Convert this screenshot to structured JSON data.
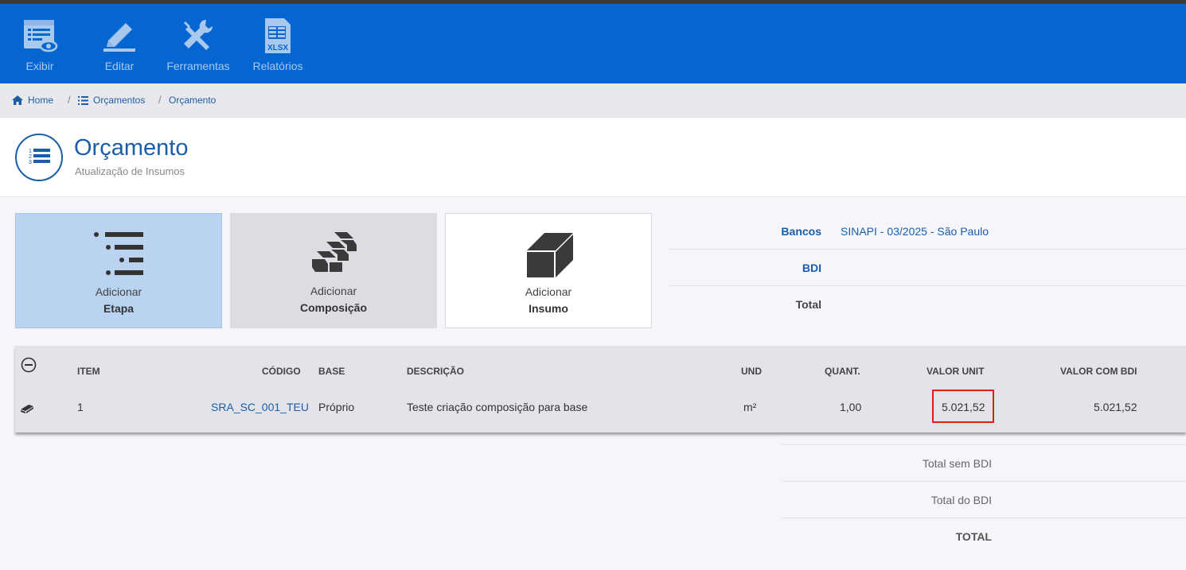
{
  "toolbar": {
    "items": [
      {
        "label": "Exibir",
        "icon": "view-list-eye-icon"
      },
      {
        "label": "Editar",
        "icon": "pencil-icon"
      },
      {
        "label": "Ferramentas",
        "icon": "tools-icon"
      },
      {
        "label": "Relatórios",
        "icon": "xlsx-file-icon"
      }
    ]
  },
  "breadcrumb": {
    "items": [
      {
        "label": "Home",
        "icon": "home-icon"
      },
      {
        "label": "Orçamentos",
        "icon": "list-icon"
      },
      {
        "label": "Orçamento"
      }
    ],
    "separator": "/"
  },
  "page": {
    "title": "Orçamento",
    "subtitle": "Atualização de Insumos",
    "icon": "numbered-list-icon"
  },
  "cards": [
    {
      "line1": "Adicionar",
      "line2": "Etapa",
      "icon": "numbered-steps-icon",
      "state": "active"
    },
    {
      "line1": "Adicionar",
      "line2": "Composição",
      "icon": "bricks-icon",
      "state": "disabled"
    },
    {
      "line1": "Adicionar",
      "line2": "Insumo",
      "icon": "block-icon",
      "state": "normal"
    }
  ],
  "info": {
    "banks_label": "Bancos",
    "banks_value": "SINAPI - 03/2025 - São Paulo",
    "bdi_label": "BDI",
    "bdi_value": "",
    "total_label": "Total",
    "total_value": ""
  },
  "table": {
    "columns": [
      "ITEM",
      "CÓDIGO",
      "BASE",
      "DESCRIÇÃO",
      "UND",
      "QUANT.",
      "VALOR UNIT",
      "VALOR COM BDI"
    ],
    "rows": [
      {
        "item": "1",
        "codigo": "SRA_SC_001_TEU",
        "base": "Próprio",
        "descricao": "Teste criação composição para base",
        "und": "m²",
        "quant": "1,00",
        "valor_unit": "5.021,52",
        "valor_bdi": "5.021,52"
      }
    ]
  },
  "totals": {
    "sem_bdi_label": "Total sem BDI",
    "do_bdi_label": "Total do BDI",
    "total_label": "TOTAL"
  },
  "colors": {
    "toolbar_bg": "#0566d2",
    "accent": "#1a5ea8",
    "highlight_border": "#e41b1b",
    "card_active_bg": "#b9d3f0",
    "card_disabled_bg": "#dcdce2"
  }
}
